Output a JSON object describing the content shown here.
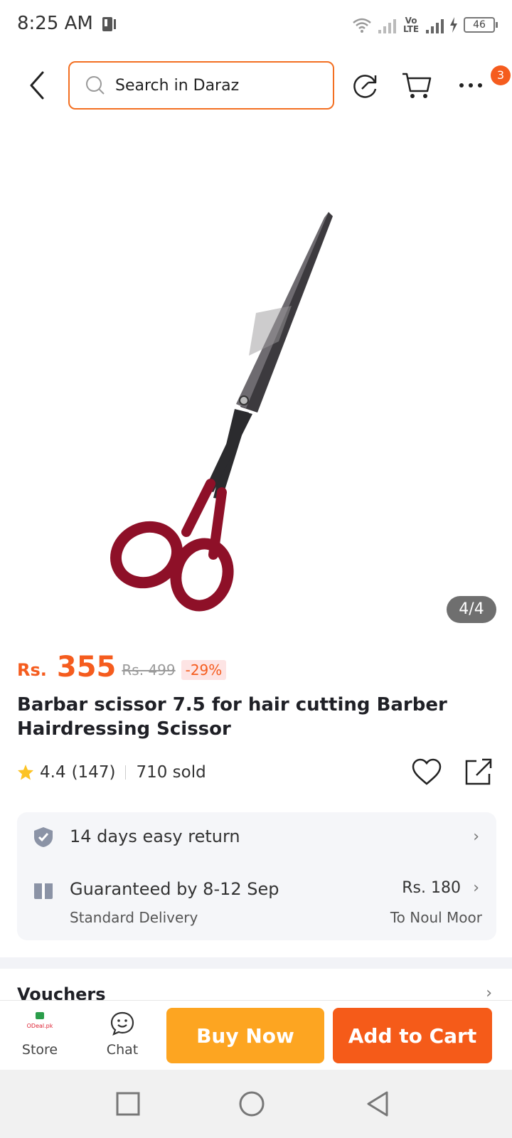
{
  "status_bar": {
    "time": "8:25 AM",
    "network_label": "Vo LTE",
    "battery": "46"
  },
  "header": {
    "search_placeholder": "Search in Daraz",
    "cart_badge": "3"
  },
  "gallery": {
    "counter": "4/4"
  },
  "product": {
    "currency": "Rs.",
    "price": "355",
    "original_price": "Rs. 499",
    "discount": "-29%",
    "title": "Barbar scissor 7.5  for hair cutting Barber Hairdressing Scissor",
    "rating": "4.4",
    "reviews": "(147)",
    "sold": "710 sold"
  },
  "services": {
    "return_label": "14 days easy return",
    "delivery_label": "Guaranteed by 8-12 Sep",
    "delivery_type": "Standard Delivery",
    "delivery_fee": "Rs. 180",
    "destination": "To Noul Moor"
  },
  "sections": {
    "vouchers": "Vouchers"
  },
  "action_bar": {
    "store_label": "Store",
    "store_logo_text": "ODeal.pk",
    "chat_label": "Chat",
    "buy_now": "Buy Now",
    "add_to_cart": "Add to Cart"
  },
  "colors": {
    "brand_orange": "#f55c1e",
    "buy_now_yellow": "#fda521"
  },
  "icons": [
    "notification-icon",
    "wifi-icon",
    "signal-icon",
    "charging-icon",
    "battery-icon",
    "back-icon",
    "search-icon",
    "refresh-icon",
    "cart-icon",
    "more-icon",
    "star-icon",
    "heart-icon",
    "share-icon",
    "shield-check-icon",
    "gift-box-icon",
    "chevron-right-icon",
    "store-icon",
    "chat-icon",
    "square-nav-icon",
    "circle-nav-icon",
    "triangle-back-nav-icon"
  ]
}
